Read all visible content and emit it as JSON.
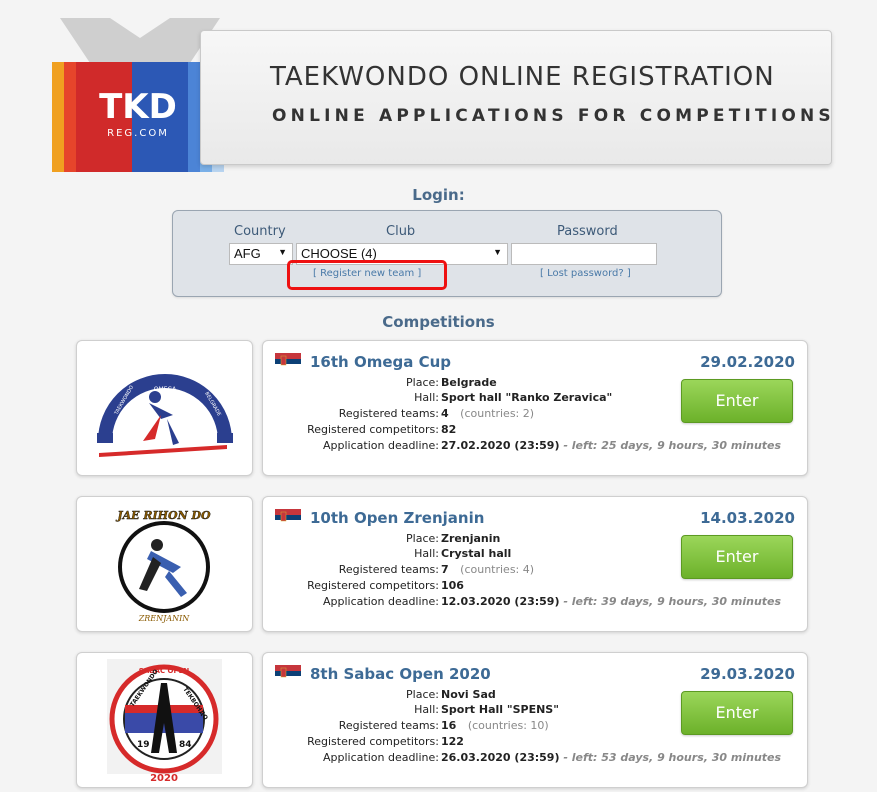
{
  "brand": {
    "logo_text": "TKD",
    "logo_sub": "REG.COM",
    "title": "TAEKWONDO ONLINE REGISTRATION",
    "subtitle": "ONLINE APPLICATIONS FOR COMPETITIONS"
  },
  "login": {
    "heading": "Login:",
    "country_label": "Country",
    "club_label": "Club",
    "password_label": "Password",
    "country_value": "AFG",
    "club_value": "CHOOSE (4)",
    "register_link": "[ Register new team ]",
    "lost_password_link": "[ Lost password? ]"
  },
  "competitions_heading": "Competitions",
  "field_labels": {
    "place": "Place:",
    "hall": "Hall:",
    "teams": "Registered teams:",
    "competitors": "Registered competitors:",
    "deadline": "Application deadline:"
  },
  "enter_label": "Enter",
  "competitions": [
    {
      "name": "16th Omega Cup",
      "date": "29.02.2020",
      "place": "Belgrade",
      "hall": "Sport hall \"Ranko Zeravica\"",
      "teams": "4",
      "countries": "(countries: 2)",
      "competitors": "82",
      "deadline": "27.02.2020 (23:59)",
      "left": "- left: 25 days, 9 hours, 30 minutes"
    },
    {
      "name": "10th Open Zrenjanin",
      "date": "14.03.2020",
      "place": "Zrenjanin",
      "hall": "Crystal hall",
      "teams": "7",
      "countries": "(countries: 4)",
      "competitors": "106",
      "deadline": "12.03.2020 (23:59)",
      "left": "- left: 39 days, 9 hours, 30 minutes"
    },
    {
      "name": "8th Sabac Open 2020",
      "date": "29.03.2020",
      "place": "Novi Sad",
      "hall": "Sport Hall \"SPENS\"",
      "teams": "16",
      "countries": "(countries: 10)",
      "competitors": "122",
      "deadline": "26.03.2020 (23:59)",
      "left": "- left: 53 days, 9 hours, 30 minutes"
    }
  ],
  "logos": {
    "omega_top": "OMEGA",
    "omega_left": "TAEKWONDO",
    "omega_right": "BELGRADE",
    "zrenjanin_top": "JAE RIHON DO",
    "zrenjanin_bottom": "ZRENJANIN",
    "sabac_top": "SABAC OPEN",
    "sabac_year_left": "19",
    "sabac_year_right": "84",
    "sabac_year": "2020",
    "sabac_left_text": "TAEKWONDO",
    "sabac_right_text": "ТЕКВОНДО"
  }
}
